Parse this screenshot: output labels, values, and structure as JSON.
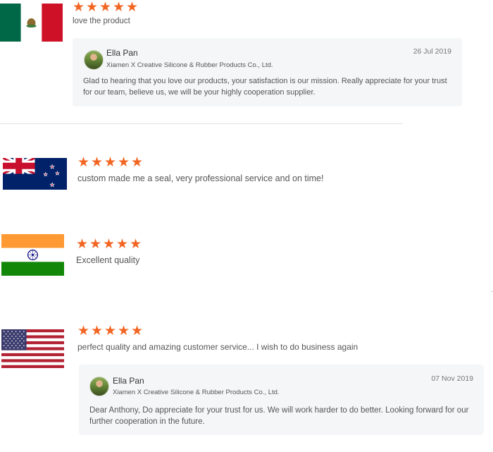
{
  "reviews": [
    {
      "country_flag": "mexico-flag",
      "rating": 5,
      "stars": [
        "★",
        "★",
        "★",
        "★",
        "★"
      ],
      "comment": "love the product",
      "reply": {
        "author": "Ella Pan",
        "company": "Xiamen X Creative Silicone & Rubber Products Co., Ltd.",
        "date": "26 Jul 2019",
        "text_line1": "Glad to hearing that you love our products, your satisfaction is our mission. Really appreciate for  your trust",
        "text_line2": "for our team, believe us, we will be your highly cooperation supplier."
      }
    },
    {
      "country_flag": "new-zealand-flag",
      "rating": 5,
      "stars": [
        "★",
        "★",
        "★",
        "★",
        "★"
      ],
      "comment": "custom made me a seal, very professional service and on time!"
    },
    {
      "country_flag": "india-flag",
      "rating": 5,
      "stars": [
        "★",
        "★",
        "★",
        "★",
        "★"
      ],
      "comment": "Excellent quality"
    },
    {
      "country_flag": "usa-flag",
      "rating": 5,
      "stars": [
        "★",
        "★",
        "★",
        "★",
        "★"
      ],
      "comment": "perfect quality and amazing customer service... I wish to do business again",
      "reply": {
        "author": "Ella Pan",
        "company": "Xiamen X Creative Silicone & Rubber Products Co., Ltd.",
        "date": "07 Nov 2019",
        "text_line1": "Dear Anthony, Do appreciate for your trust for us. We will work harder to do better. Looking forward for our",
        "text_line2": "further cooperation in the future."
      }
    }
  ],
  "colors": {
    "star": "#f26522",
    "reply_background": "#f5f6f8",
    "divider": "#e3e3e3"
  }
}
